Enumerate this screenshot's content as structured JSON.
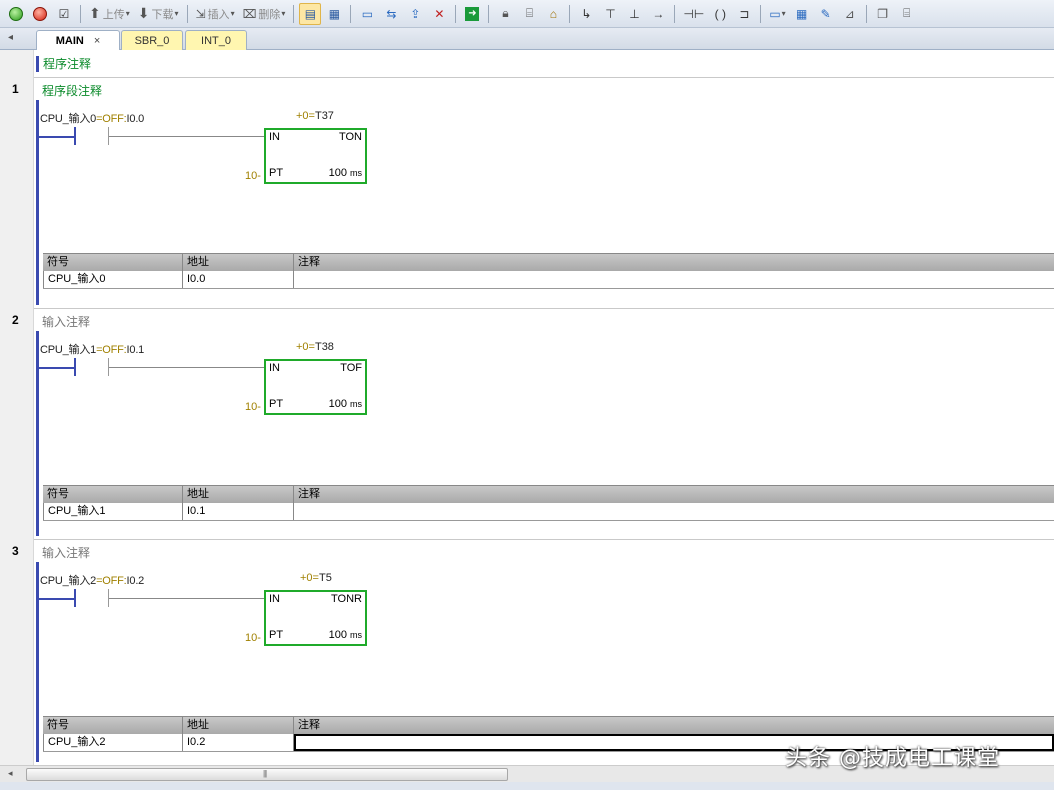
{
  "toolbar": {
    "upload_label": "上传",
    "download_label": "下载",
    "insert_label": "插入",
    "delete_label": "删除"
  },
  "tabs": [
    {
      "label": "MAIN",
      "close": "×"
    },
    {
      "label": "SBR_0"
    },
    {
      "label": "INT_0"
    }
  ],
  "program_comment": "程序注释",
  "symbol_headers": {
    "symbol": "符号",
    "address": "地址",
    "comment": "注释"
  },
  "networks": [
    {
      "number": "1",
      "comment": "程序段注释",
      "contact_label": "CPU_输入0",
      "contact_state": "=OFF:",
      "contact_addr": "I0.0",
      "timer_prefix": "+0=",
      "timer_name": "T37",
      "timer_type": "TON",
      "in_label": "IN",
      "pt_label": "PT",
      "pt_value": "10-",
      "resolution": "100",
      "unit": "ms",
      "sym_symbol": "CPU_输入0",
      "sym_address": "I0.0",
      "sym_comment": ""
    },
    {
      "number": "2",
      "comment": "输入注释",
      "contact_label": "CPU_输入1",
      "contact_state": "=OFF:",
      "contact_addr": "I0.1",
      "timer_prefix": "+0=",
      "timer_name": "T38",
      "timer_type": "TOF",
      "in_label": "IN",
      "pt_label": "PT",
      "pt_value": "10-",
      "resolution": "100",
      "unit": "ms",
      "sym_symbol": "CPU_输入1",
      "sym_address": "I0.1",
      "sym_comment": ""
    },
    {
      "number": "3",
      "comment": "输入注释",
      "contact_label": "CPU_输入2",
      "contact_state": "=OFF:",
      "contact_addr": "I0.2",
      "timer_prefix": "+0=",
      "timer_name": "T5",
      "timer_type": "TONR",
      "in_label": "IN",
      "pt_label": "PT",
      "pt_value": "10-",
      "resolution": "100",
      "unit": "ms",
      "sym_symbol": "CPU_输入2",
      "sym_address": "I0.2",
      "sym_comment": ""
    }
  ],
  "scroll_grip": "|||",
  "watermark": "头条 @技成电工课堂",
  "colors": {
    "rail": "#3a4ab0",
    "timer_border": "#1faa2a",
    "comment_green": "#0a8a2a",
    "tab_yellow": "#fff6b0"
  }
}
